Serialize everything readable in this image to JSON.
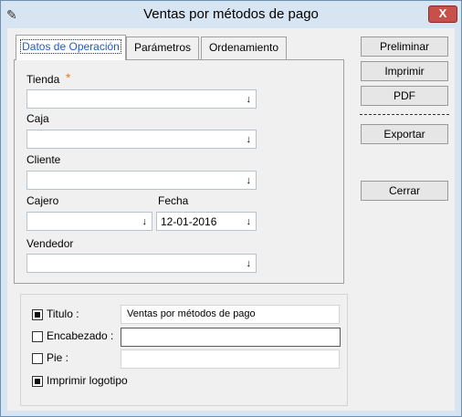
{
  "window": {
    "title": "Ventas por métodos de pago",
    "close_glyph": "X"
  },
  "tabs": [
    {
      "label": "Datos de Operación"
    },
    {
      "label": "Parámetros"
    },
    {
      "label": "Ordenamiento"
    }
  ],
  "form": {
    "tienda": {
      "label": "Tienda",
      "required_mark": "*",
      "value": ""
    },
    "caja": {
      "label": "Caja",
      "value": ""
    },
    "cliente": {
      "label": "Cliente",
      "value": ""
    },
    "cajero": {
      "label": "Cajero",
      "value": ""
    },
    "fecha": {
      "label": "Fecha",
      "value": "12-01-2016"
    },
    "vendedor": {
      "label": "Vendedor",
      "value": ""
    },
    "dropdown_glyph": "↓"
  },
  "buttons": {
    "preliminar": "Preliminar",
    "imprimir": "Imprimir",
    "pdf": "PDF",
    "exportar": "Exportar",
    "cerrar": "Cerrar"
  },
  "options": {
    "titulo": {
      "label": "Titulo :",
      "checked": true,
      "value": "Ventas por métodos de pago"
    },
    "encabezado": {
      "label": "Encabezado :",
      "checked": false,
      "value": ""
    },
    "pie": {
      "label": "Pie :",
      "checked": false,
      "value": ""
    },
    "imprimir_logotipo": {
      "label": "Imprimir logotipo",
      "checked": true
    }
  },
  "colors": {
    "required": "#f27b1a",
    "active_tab_text": "#1f5cc7",
    "close_button": "#c7504a"
  }
}
